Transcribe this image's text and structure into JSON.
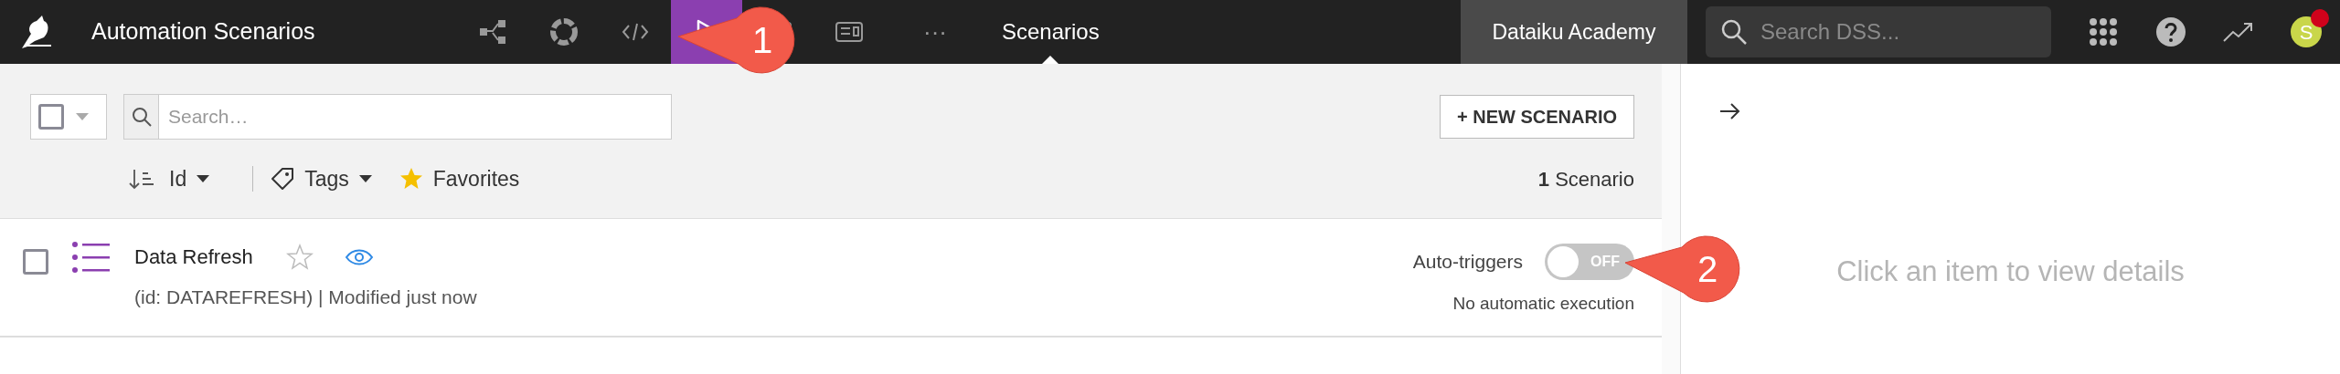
{
  "topbar": {
    "project_title": "Automation Scenarios",
    "nav_icons": [
      {
        "kind": "flow",
        "selected": false
      },
      {
        "kind": "lab",
        "selected": false
      },
      {
        "kind": "code",
        "selected": false
      },
      {
        "kind": "run",
        "selected": true
      },
      {
        "kind": "dashboard",
        "selected": false
      },
      {
        "kind": "wiki",
        "selected": false
      }
    ],
    "more": "···",
    "section": "Scenarios",
    "academy_button": "Dataiku Academy",
    "search": {
      "placeholder": "Search DSS..."
    },
    "avatar": {
      "initial": "S",
      "notification": true
    }
  },
  "toolbar": {
    "search": {
      "placeholder": "Search…"
    },
    "new_button": "+ NEW SCENARIO",
    "sort": "Id",
    "tags": "Tags",
    "favorites": "Favorites",
    "count": "**1** Scenario"
  },
  "scenarios": [
    {
      "name": "Data Refresh",
      "favorite": false,
      "watched": true,
      "selected": false,
      "meta": "(id: DATAREFRESH) | Modified just now",
      "trigger_label": "Auto-triggers",
      "auto_triggers": false,
      "toggle_text": "OFF",
      "trigger_note": "No automatic execution"
    }
  ],
  "details": {
    "placeholder_text": "Click an item to view details"
  },
  "callouts": [
    {
      "label": "1"
    },
    {
      "label": "2"
    }
  ]
}
